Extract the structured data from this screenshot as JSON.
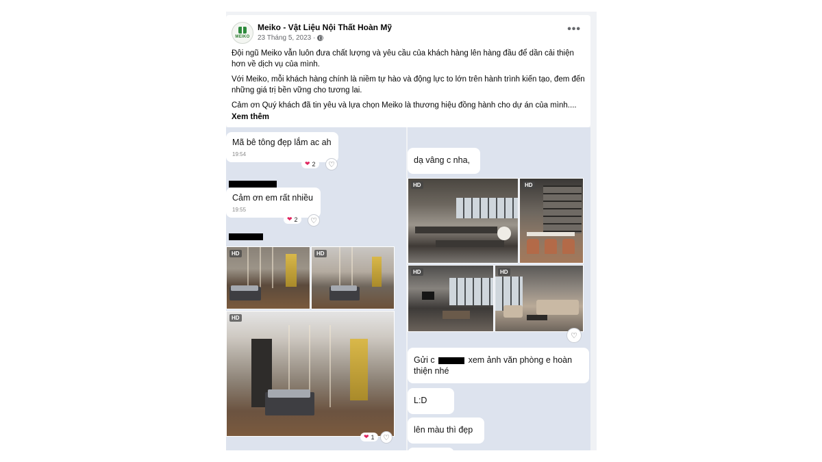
{
  "post": {
    "page_name": "Meiko - Vật Liệu Nội Thất Hoàn Mỹ",
    "avatar_text": "MEIKO",
    "date": "23 Tháng 5, 2023 ·",
    "more_label": "•••",
    "paragraphs": [
      "Đội ngũ Meiko vẫn luôn đưa chất lượng và yêu cầu của khách hàng lên hàng đầu để dần cải thiện hơn về dịch vụ của mình.",
      "Với Meiko, mỗi khách hàng chính là niềm tự hào và động lực to lớn trên hành trình kiến tạo, đem đến những giá trị bền vững cho tương lai.",
      "Cảm ơn Quý khách đã tin yêu và lựa chọn Meiko là thương hiệu đồng hành cho dự án của mình...."
    ],
    "see_more": "Xem thêm"
  },
  "chat_left": {
    "msg1": {
      "text": "Mã bê tông đẹp lắm ac ah",
      "time": "19:54",
      "reaction_count": "2"
    },
    "msg2": {
      "text": "Cảm ơn em rất nhiều",
      "time": "19:55",
      "reaction_count": "2"
    },
    "photos_reaction_count": "1",
    "hd_label": "HD"
  },
  "chat_right": {
    "msg1": {
      "text": "dạ vâng c nha,"
    },
    "msg2": {
      "text_before": "Gửi c",
      "text_after": "xem ảnh văn phòng e hoàn thiện nhé"
    },
    "msg3": {
      "text": "L:D"
    },
    "msg4": {
      "text": "lên màu thì đẹp"
    },
    "hd_label": "HD"
  },
  "icons": {
    "heart": "heart-icon",
    "globe": "globe-icon",
    "more": "more-options-icon"
  },
  "colors": {
    "chat_background": "#dde3ee",
    "bubble": "#ffffff",
    "reaction_heart": "#e0245e",
    "brand_green": "#2e7d32"
  }
}
